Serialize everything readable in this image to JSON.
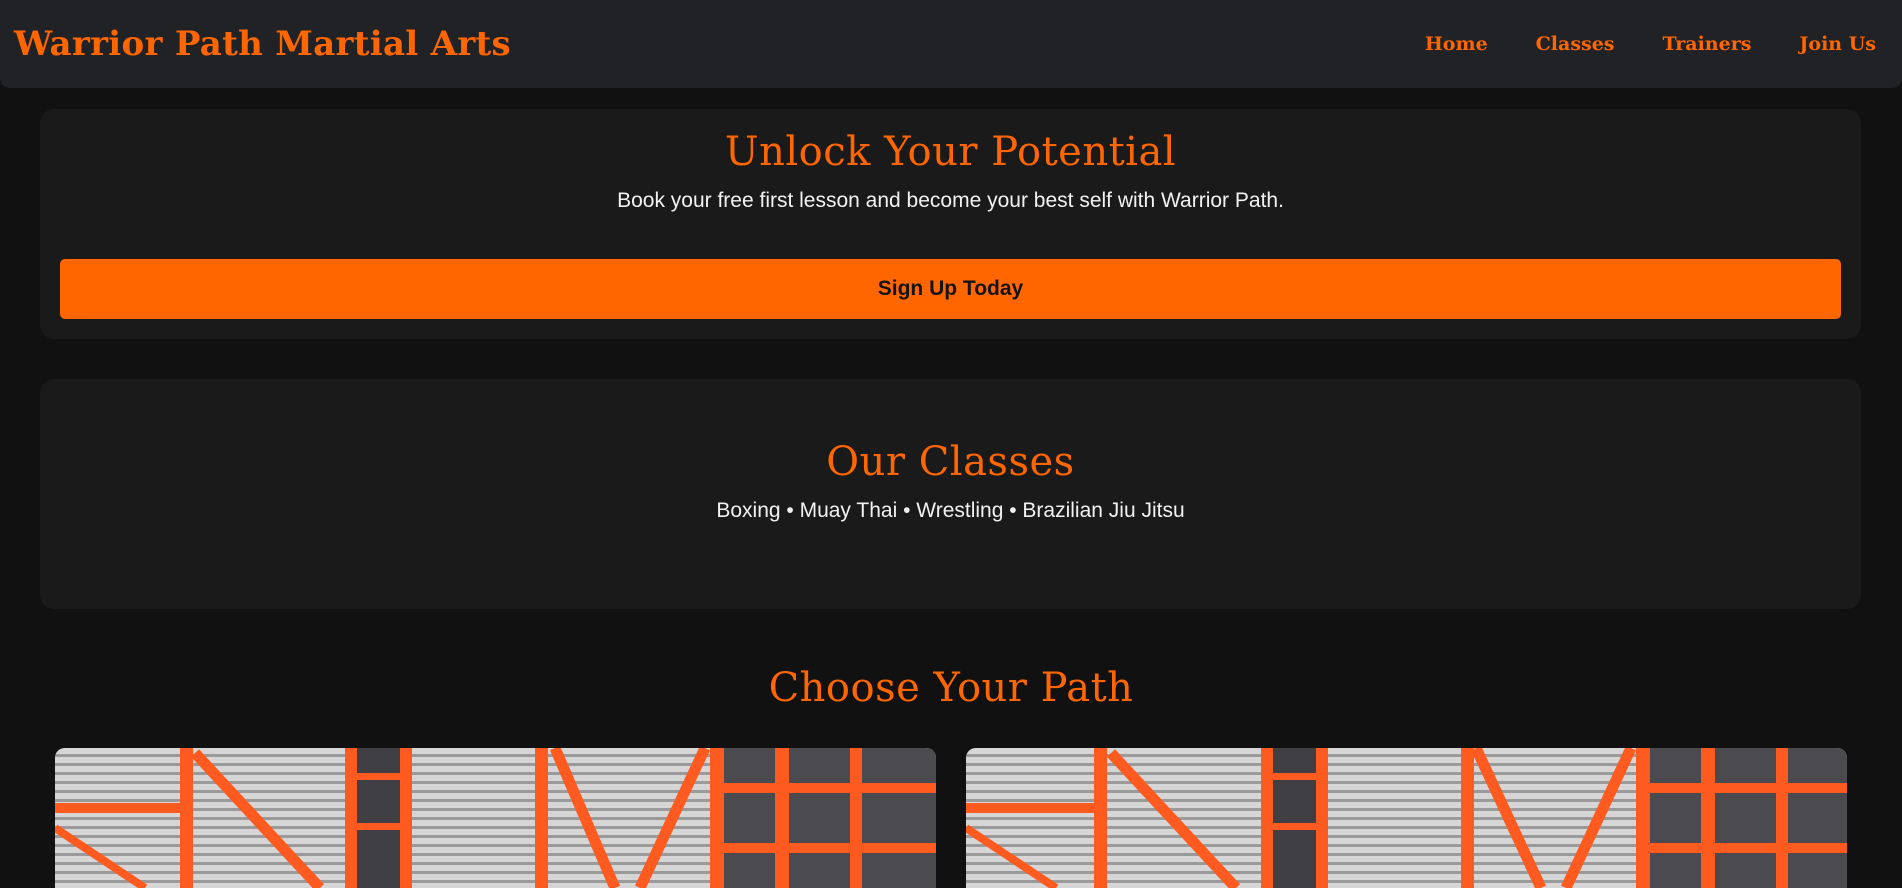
{
  "nav": {
    "brand": "Warrior Path Martial Arts",
    "links": [
      "Home",
      "Classes",
      "Trainers",
      "Join Us"
    ]
  },
  "hero": {
    "title": "Unlock Your Potential",
    "subtitle": "Book your free first lesson and become your best self with Warrior Path.",
    "cta_label": "Sign Up Today"
  },
  "classes": {
    "title": "Our Classes",
    "list": "Boxing • Muay Thai • Wrestling • Brazilian Jiu Jitsu"
  },
  "paths": {
    "title": "Choose Your Path",
    "cards": [
      {
        "image_icon": "gym-interior-image"
      },
      {
        "image_icon": "gym-interior-image"
      }
    ]
  },
  "colors": {
    "accent": "#ff6600",
    "background": "#111111",
    "panel": "#1a1a1a",
    "navbar": "#202226",
    "text": "#f2f2f2"
  }
}
